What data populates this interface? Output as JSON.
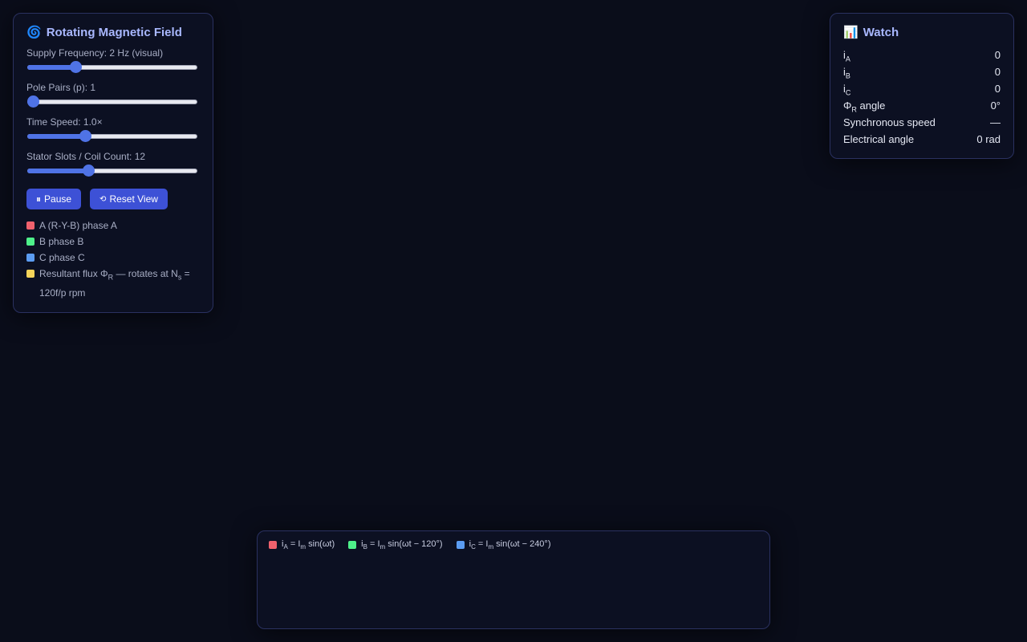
{
  "control_panel": {
    "icon": "spiral-icon",
    "icon_glyph": "🌀",
    "title": "Rotating Magnetic Field",
    "sliders": [
      {
        "name": "supply-frequency",
        "label": "Supply Frequency: 2 Hz (visual)",
        "fraction": 0.27
      },
      {
        "name": "pole-pairs",
        "label": "Pole Pairs (p): 1",
        "fraction": 0.0
      },
      {
        "name": "time-speed",
        "label": "Time Speed: 1.0×",
        "fraction": 0.33
      },
      {
        "name": "stator-slots",
        "label": "Stator Slots / Coil Count: 12",
        "fraction": 0.35
      }
    ],
    "pause_label": "Pause",
    "pause_glyph": "⏸",
    "reset_label": "Reset View",
    "reset_glyph": "⟲",
    "legend": [
      {
        "color": "#f0616d",
        "text": "A (R-Y-B) phase A"
      },
      {
        "color": "#4ef08a",
        "text": "B phase B"
      },
      {
        "color": "#5b9cf2",
        "text": "C phase C"
      },
      {
        "color": "#f5d45a",
        "text_pre": "Resultant flux Φ",
        "sub1": "R",
        "text_mid": " — rotates at N",
        "sub2": "s",
        "text_post": " = 120f/p rpm"
      }
    ]
  },
  "watch_panel": {
    "icon_glyph": "📊",
    "title": "Watch",
    "rows": [
      {
        "label": "i",
        "sub": "A",
        "suffix": "",
        "value": "0"
      },
      {
        "label": "i",
        "sub": "B",
        "suffix": "",
        "value": "0"
      },
      {
        "label": "i",
        "sub": "C",
        "suffix": "",
        "value": "0"
      },
      {
        "label": "Φ",
        "sub": "R",
        "suffix": " angle",
        "value": "0°"
      },
      {
        "label": "Synchronous speed",
        "sub": "",
        "suffix": "",
        "value": "—"
      },
      {
        "label": "Electrical angle",
        "sub": "",
        "suffix": "",
        "value": "0 rad"
      }
    ]
  },
  "wave_panel": {
    "legend": [
      {
        "color": "#f0616d",
        "pre": "i",
        "sub1": "A",
        "mid": " = I",
        "sub2": "m",
        "post": " sin(ωt)"
      },
      {
        "color": "#4ef08a",
        "pre": "i",
        "sub1": "B",
        "mid": " = I",
        "sub2": "m",
        "post": " sin(ωt − 120°)"
      },
      {
        "color": "#5b9cf2",
        "pre": "i",
        "sub1": "C",
        "mid": " = I",
        "sub2": "m",
        "post": " sin(ωt − 240°)"
      }
    ]
  }
}
